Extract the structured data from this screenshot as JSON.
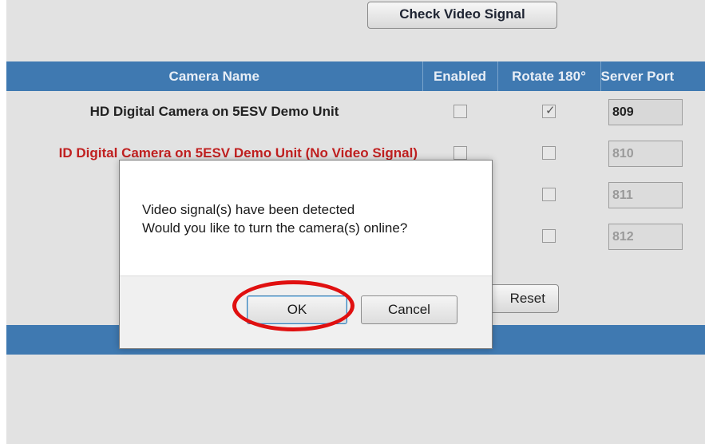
{
  "toolbar": {
    "check_video_signal_label": "Check Video Signal"
  },
  "table": {
    "headers": {
      "camera_name": "Camera Name",
      "enabled": "Enabled",
      "rotate": "Rotate 180°",
      "server_port": "Server Port"
    },
    "rows": [
      {
        "name": "HD Digital Camera on 5ESV Demo Unit",
        "enabled": false,
        "rotate": true,
        "port": "809"
      },
      {
        "name": "ID Digital Camera on 5ESV Demo Unit (No Video Signal)",
        "enabled": false,
        "rotate": false,
        "port": "810"
      },
      {
        "name": "",
        "enabled": false,
        "rotate": false,
        "port": "811"
      },
      {
        "name": "",
        "enabled": false,
        "rotate": false,
        "port": "812"
      }
    ]
  },
  "reset_label": "Reset",
  "dialog": {
    "line1": "Video signal(s) have been detected",
    "line2": "Would you like to turn the camera(s) online?",
    "ok_label": "OK",
    "cancel_label": "Cancel"
  },
  "colors": {
    "header_bg": "#3f79b1",
    "error_text": "#c02020",
    "highlight": "#e01010"
  },
  "icons": {
    "checkmark": "check-icon"
  }
}
